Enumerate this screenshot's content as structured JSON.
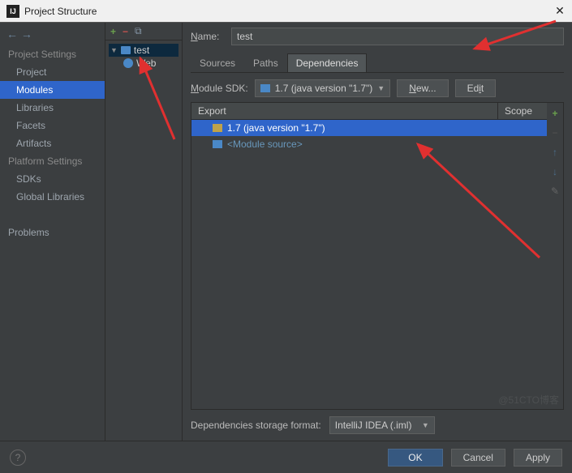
{
  "window": {
    "title": "Project Structure"
  },
  "sidebar": {
    "sections": [
      {
        "title": "Project Settings",
        "items": [
          "Project",
          "Modules",
          "Libraries",
          "Facets",
          "Artifacts"
        ],
        "selected": 1
      },
      {
        "title": "Platform Settings",
        "items": [
          "SDKs",
          "Global Libraries"
        ]
      },
      {
        "title": "",
        "items": [
          "Problems"
        ]
      }
    ]
  },
  "tree": {
    "root": "test",
    "child": "Web"
  },
  "form": {
    "name_label": "Name:",
    "name_value": "test",
    "tabs": [
      "Sources",
      "Paths",
      "Dependencies"
    ],
    "active_tab": 2,
    "sdk_label": "Module SDK:",
    "sdk_value": "1.7 (java version \"1.7\")",
    "btn_new": "New...",
    "btn_edit": "Edit",
    "table": {
      "headers": [
        "Export",
        "Scope"
      ],
      "rows": [
        {
          "icon": "folder",
          "text": "1.7 (java version \"1.7\")",
          "selected": true
        },
        {
          "icon": "src",
          "text": "<Module source>",
          "selected": false
        }
      ]
    },
    "storage_label": "Dependencies storage format:",
    "storage_value": "IntelliJ IDEA (.iml)"
  },
  "footer": {
    "ok": "OK",
    "cancel": "Cancel",
    "apply": "Apply"
  },
  "watermark": "@51CTO博客"
}
